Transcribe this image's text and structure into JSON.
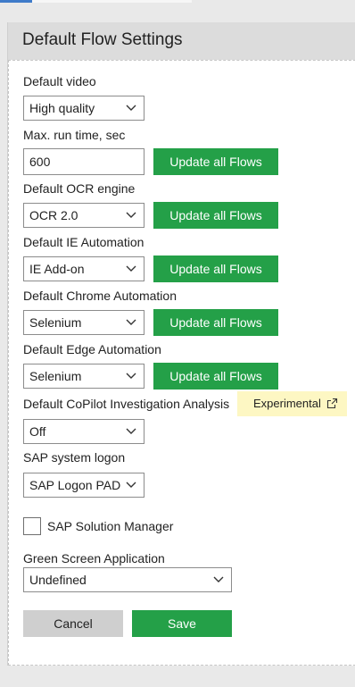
{
  "header": {
    "title": "Default Flow Settings"
  },
  "fields": {
    "default_video": {
      "label": "Default video",
      "value": "High quality"
    },
    "max_run_time": {
      "label": "Max. run time, sec",
      "value": "600",
      "button": "Update all Flows"
    },
    "ocr_engine": {
      "label": "Default OCR engine",
      "value": "OCR 2.0",
      "button": "Update all Flows"
    },
    "ie_automation": {
      "label": "Default IE Automation",
      "value": "IE Add-on",
      "button": "Update all Flows"
    },
    "chrome_automation": {
      "label": "Default Chrome Automation",
      "value": "Selenium",
      "button": "Update all Flows"
    },
    "edge_automation": {
      "label": "Default Edge Automation",
      "value": "Selenium",
      "button": "Update all Flows"
    },
    "copilot_analysis": {
      "label": "Default CoPilot Investigation Analysis",
      "value": "Off",
      "badge": "Experimental"
    },
    "sap_logon": {
      "label": "SAP system logon",
      "value": "SAP Logon PAD"
    },
    "sap_solution_manager": {
      "label": "SAP Solution Manager",
      "checked": false
    },
    "green_screen": {
      "label": "Green Screen Application",
      "value": "Undefined"
    }
  },
  "footer": {
    "cancel_label": "Cancel",
    "save_label": "Save"
  },
  "colors": {
    "accent": "#24a048",
    "badge_bg": "#fdf7c3",
    "header_bg": "#dcdcdc"
  },
  "icons": {
    "dropdown": "chevron-down-icon",
    "external": "external-link-icon"
  }
}
